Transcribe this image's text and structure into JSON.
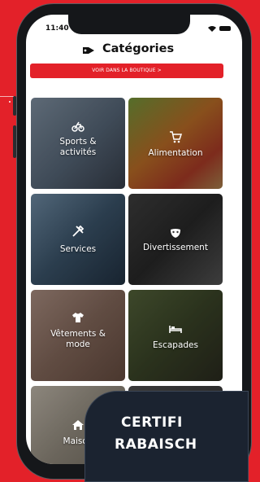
{
  "status_bar": {
    "time": "11:40"
  },
  "header": {
    "title": "Catégories",
    "icon": "tag-icon"
  },
  "shop_button": {
    "label": "VOIR DANS LA BOUTIQUE >"
  },
  "categories": [
    {
      "label": "Sports & activités",
      "icon": "bicycle-icon"
    },
    {
      "label": "Alimentation",
      "icon": "cart-icon"
    },
    {
      "label": "Services",
      "icon": "tools-icon"
    },
    {
      "label": "Divertissement",
      "icon": "mask-icon"
    },
    {
      "label": "Vêtements & mode",
      "icon": "shirt-icon"
    },
    {
      "label": "Escapades",
      "icon": "bed-icon"
    },
    {
      "label": "Maison",
      "icon": "home-icon"
    }
  ],
  "promo_banner": {
    "line1": "CERTIFI",
    "line2": "RABAISCH"
  },
  "colors": {
    "brand_red": "#e32129",
    "banner_navy": "#1b2330"
  }
}
